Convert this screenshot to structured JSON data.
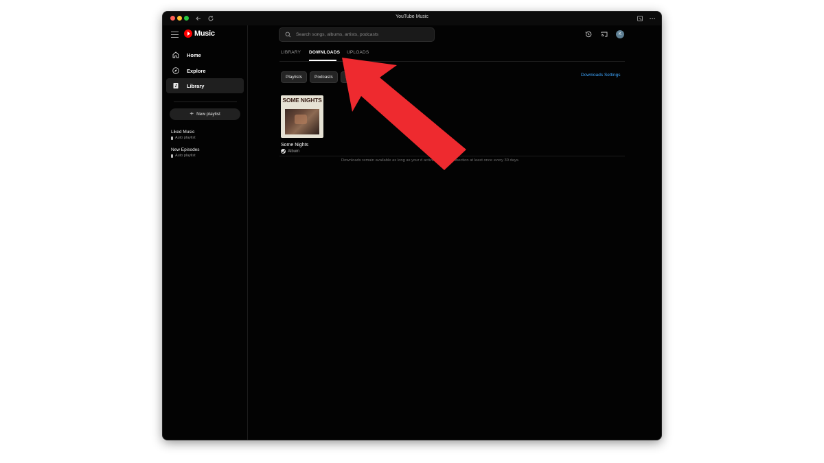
{
  "window": {
    "title": "YouTube Music"
  },
  "sidebar": {
    "logo_text": "Music",
    "nav": [
      {
        "label": "Home",
        "icon": "home-icon"
      },
      {
        "label": "Explore",
        "icon": "compass-icon"
      },
      {
        "label": "Library",
        "icon": "library-icon",
        "active": true
      }
    ],
    "new_playlist_label": "New playlist",
    "playlists": [
      {
        "title": "Liked Music",
        "subtitle": "Auto playlist"
      },
      {
        "title": "New Episodes",
        "subtitle": "Auto playlist"
      }
    ]
  },
  "header": {
    "search_placeholder": "Search songs, albums, artists, podcasts",
    "avatar_initial": "K"
  },
  "tabs": [
    {
      "label": "LIBRARY"
    },
    {
      "label": "DOWNLOADS",
      "active": true
    },
    {
      "label": "UPLOADS"
    }
  ],
  "filters": [
    {
      "label": "Playlists"
    },
    {
      "label": "Podcasts"
    },
    {
      "label": "S"
    }
  ],
  "downloads_settings_label": "Downloads Settings",
  "downloads": [
    {
      "art_text": "SOME NIGHTS",
      "title": "Some Nights",
      "subtitle": "Album"
    }
  ],
  "notice_text": "Downloads remain available as long as your d                    active internet connection at least once every 30 days.",
  "annotation": {
    "arrow_color": "#ee2a2f"
  }
}
